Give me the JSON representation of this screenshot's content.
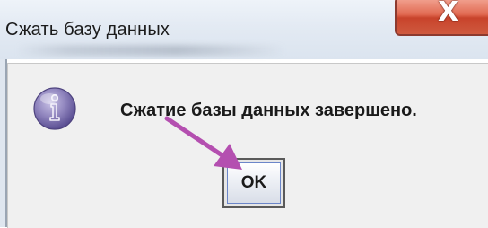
{
  "window": {
    "title": "Сжать базу данных",
    "close_label": "X"
  },
  "dialog": {
    "icon": "info-icon",
    "message": "Сжатие базы данных завершено.",
    "ok_label": "OK"
  },
  "colors": {
    "close_button": "#c8432b",
    "arrow": "#b44fb0",
    "icon": "#8a7fb5"
  }
}
